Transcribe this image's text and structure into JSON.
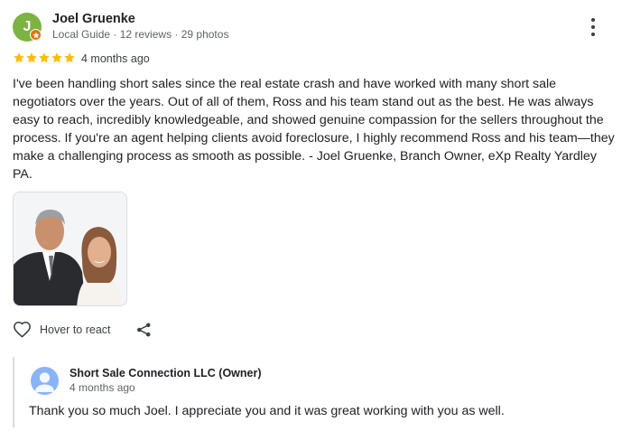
{
  "review": {
    "author_initial": "J",
    "author_name": "Joel Gruenke",
    "author_meta": "Local Guide · 12 reviews · 29 photos",
    "rating": 5,
    "date": "4 months ago",
    "text": "I've been handling short sales since the real estate crash and have worked with many short sale negotiators over the years. Out of all of them, Ross and his team stand out as the best. He was always easy to reach, incredibly knowledgeable, and showed genuine compassion for the sellers throughout the process. If you're an agent helping clients avoid foreclosure, I highly recommend Ross and his team—they make a challenging process as smooth as possible. - Joel Gruenke, Branch Owner, eXp Realty Yardley PA.",
    "avatar_color": "#7cb342",
    "badge_color": "#e8710a",
    "star_color": "#fbbc04"
  },
  "actions": {
    "react_label": "Hover to react",
    "react_icon": "heart-outline-icon",
    "share_icon": "share-icon",
    "more_icon": "more-vertical-icon"
  },
  "owner_reply": {
    "name": "Short Sale Connection LLC (Owner)",
    "date": "4 months ago",
    "text": "Thank you so much Joel. I appreciate you and it was great working with you as well.",
    "avatar_color": "#8ab4f8"
  }
}
